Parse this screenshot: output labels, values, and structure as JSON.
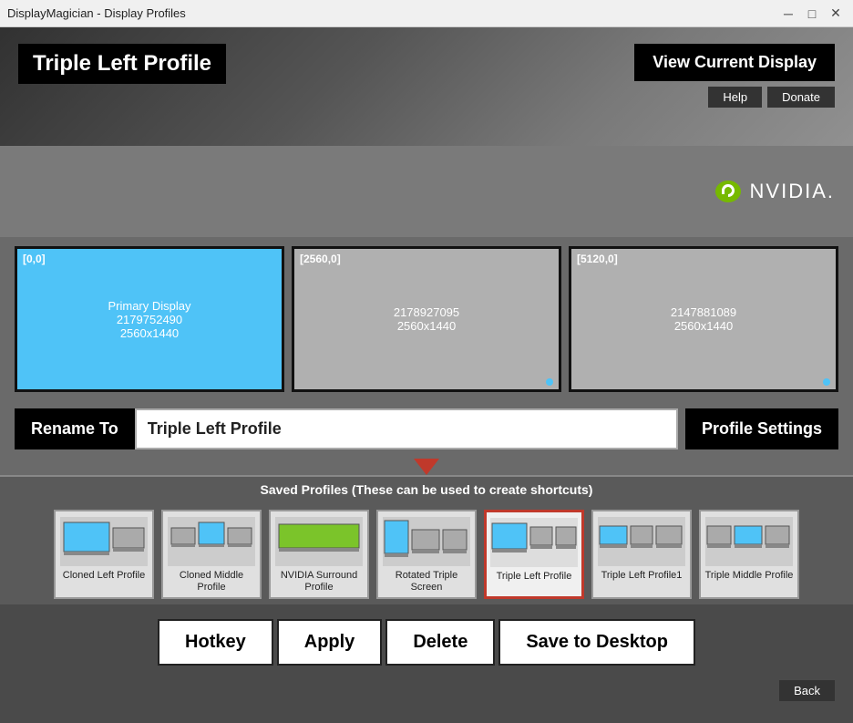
{
  "titlebar": {
    "title": "DisplayMagician - Display Profiles",
    "minimize_label": "─",
    "maximize_label": "□",
    "close_label": "✕"
  },
  "header": {
    "profile_title": "Triple Left Profile",
    "view_current_btn": "View Current Display",
    "help_btn": "Help",
    "donate_btn": "Donate"
  },
  "displays": [
    {
      "coords": "[0,0]",
      "line1": "Primary Display",
      "line2": "2179752490",
      "line3": "2560x1440",
      "type": "primary"
    },
    {
      "coords": "[2560,0]",
      "line1": "2178927095",
      "line2": "2560x1440",
      "type": "secondary"
    },
    {
      "coords": "[5120,0]",
      "line1": "2147881089",
      "line2": "2560x1440",
      "type": "secondary"
    }
  ],
  "rename": {
    "label": "Rename To",
    "value": "Triple Left Profile",
    "profile_settings_btn": "Profile Settings"
  },
  "saved_profiles": {
    "banner": "Saved Profiles (These can be used to create shortcuts)",
    "profiles": [
      {
        "name": "Cloned Left Profile",
        "type": "cloned-left"
      },
      {
        "name": "Cloned Middle Profile",
        "type": "cloned-middle"
      },
      {
        "name": "NVIDIA Surround Profile",
        "type": "nvidia-surround"
      },
      {
        "name": "Rotated Triple Screen",
        "type": "rotated-triple"
      },
      {
        "name": "Triple Left Profile",
        "type": "triple-left",
        "active": true
      },
      {
        "name": "Triple Left Profile1",
        "type": "triple-left1"
      },
      {
        "name": "Triple Middle Profile",
        "type": "triple-middle"
      }
    ]
  },
  "bottom_buttons": {
    "hotkey": "Hotkey",
    "apply": "Apply",
    "delete": "Delete",
    "save_to_desktop": "Save to Desktop",
    "back": "Back"
  }
}
